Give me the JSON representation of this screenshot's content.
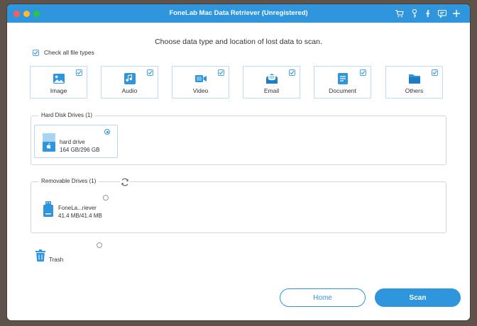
{
  "window": {
    "title": "FoneLab Mac Data Retriever (Unregistered)"
  },
  "toolbar_icons": [
    "cart-icon",
    "key-icon",
    "facebook-icon",
    "chat-icon",
    "plus-icon"
  ],
  "heading": "Choose data type and location of lost data to scan.",
  "check_all": {
    "label": "Check all file types",
    "checked": true
  },
  "file_types": [
    {
      "label": "Image",
      "icon": "image-icon",
      "checked": true
    },
    {
      "label": "Audio",
      "icon": "audio-icon",
      "checked": true
    },
    {
      "label": "Video",
      "icon": "video-icon",
      "checked": true
    },
    {
      "label": "Email",
      "icon": "email-icon",
      "checked": true
    },
    {
      "label": "Document",
      "icon": "document-icon",
      "checked": true
    },
    {
      "label": "Others",
      "icon": "folder-icon",
      "checked": true
    }
  ],
  "hard_disk": {
    "title": "Hard Disk Drives (1)",
    "drives": [
      {
        "name": "hard drive",
        "size": "164 GB/296 GB",
        "selected": true
      }
    ]
  },
  "removable": {
    "title": "Removable Drives (1)",
    "drives": [
      {
        "name": "FoneLa...riever",
        "size": "41.4 MB/41.4 MB",
        "selected": false
      }
    ]
  },
  "trash": {
    "label": "Trash",
    "selected": false
  },
  "buttons": {
    "home": "Home",
    "scan": "Scan"
  },
  "colors": {
    "accent": "#2f95dc",
    "titlebar": "#2f95dc",
    "background": "#5e524b"
  }
}
